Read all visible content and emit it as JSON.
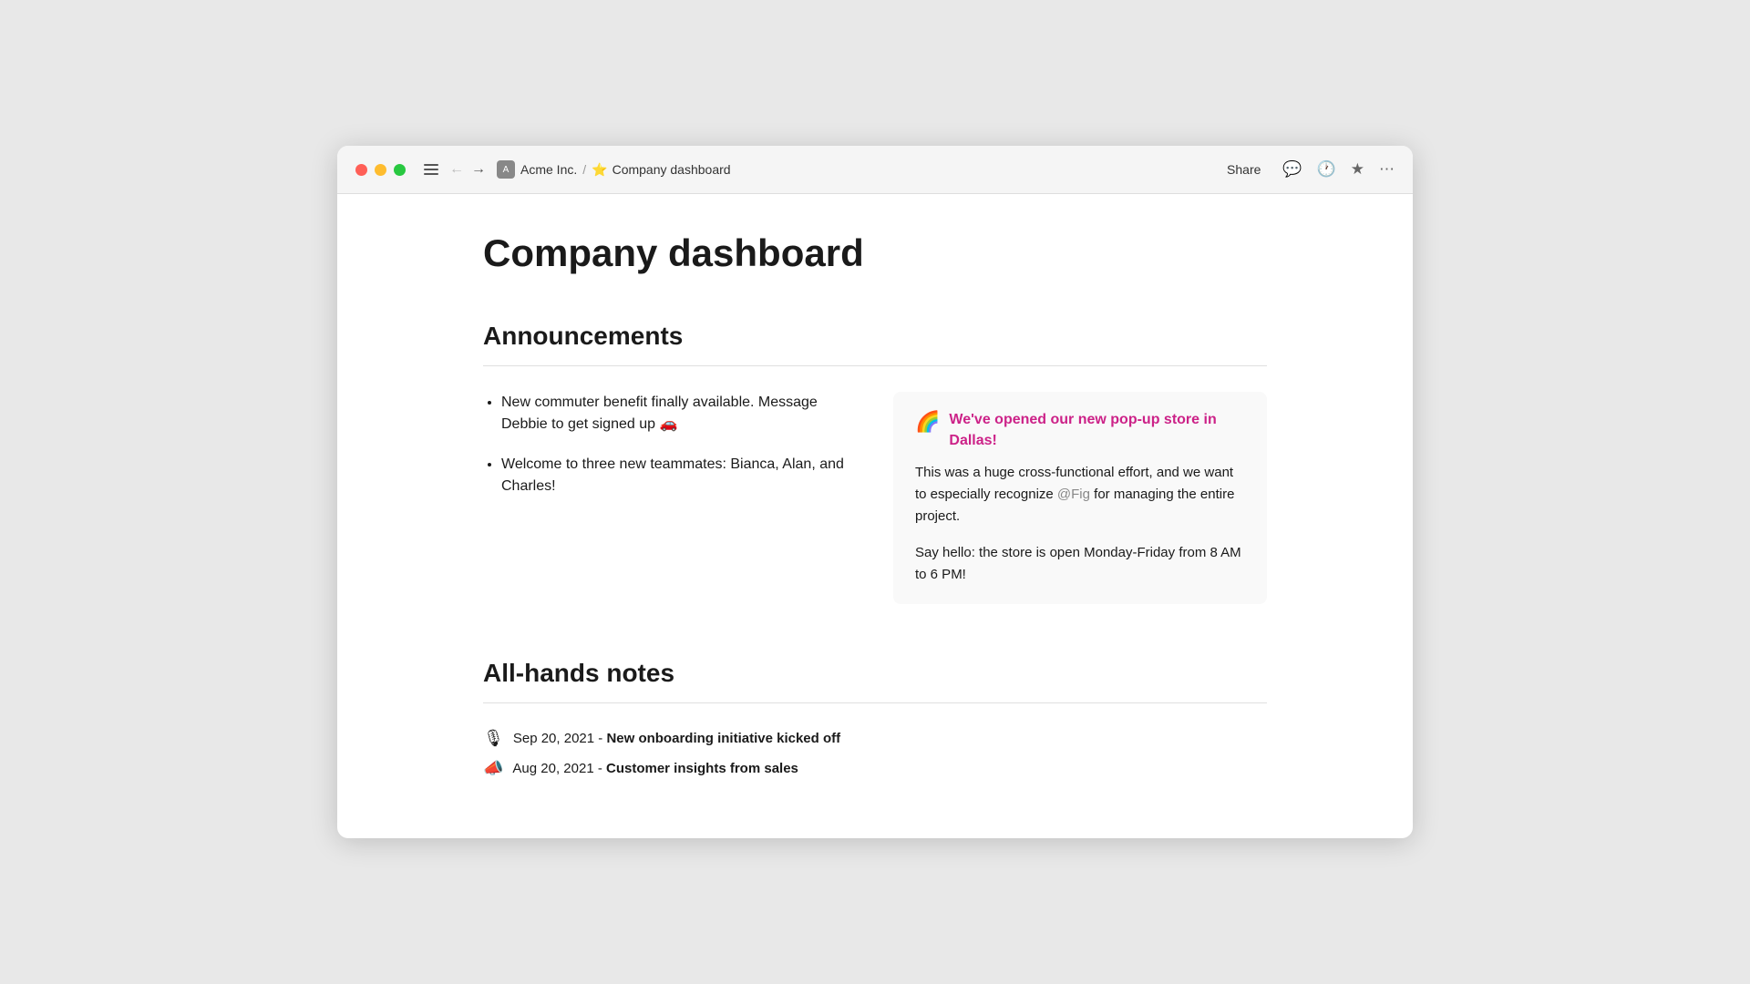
{
  "window": {
    "title": "Company dashboard"
  },
  "titlebar": {
    "workspace_label": "Acme Inc.",
    "page_label": "Company dashboard",
    "share_label": "Share",
    "breadcrumb_separator": "/"
  },
  "page": {
    "title": "Company dashboard",
    "announcements": {
      "heading": "Announcements",
      "bullets": [
        "New commuter benefit finally available. Message Debbie to get signed up 🚗",
        "Welcome to three new teammates: Bianca, Alan, and Charles!"
      ],
      "card": {
        "emoji": "🌈",
        "title": "We've opened our new pop-up store in Dallas!",
        "body1": "This was a huge cross-functional effort, and we want to especially recognize @Fig for managing the entire project.",
        "body2": "Say hello: the store is open Monday-Friday from 8 AM to 6 PM!",
        "mention": "@Fig"
      }
    },
    "all_hands": {
      "heading": "All-hands notes",
      "notes": [
        {
          "emoji": "🎙",
          "text": "Sep 20, 2021 - New onboarding initiative kicked off"
        },
        {
          "emoji": "📣",
          "text": "Aug 20, 2021 - Customer insights from sales"
        }
      ]
    }
  }
}
